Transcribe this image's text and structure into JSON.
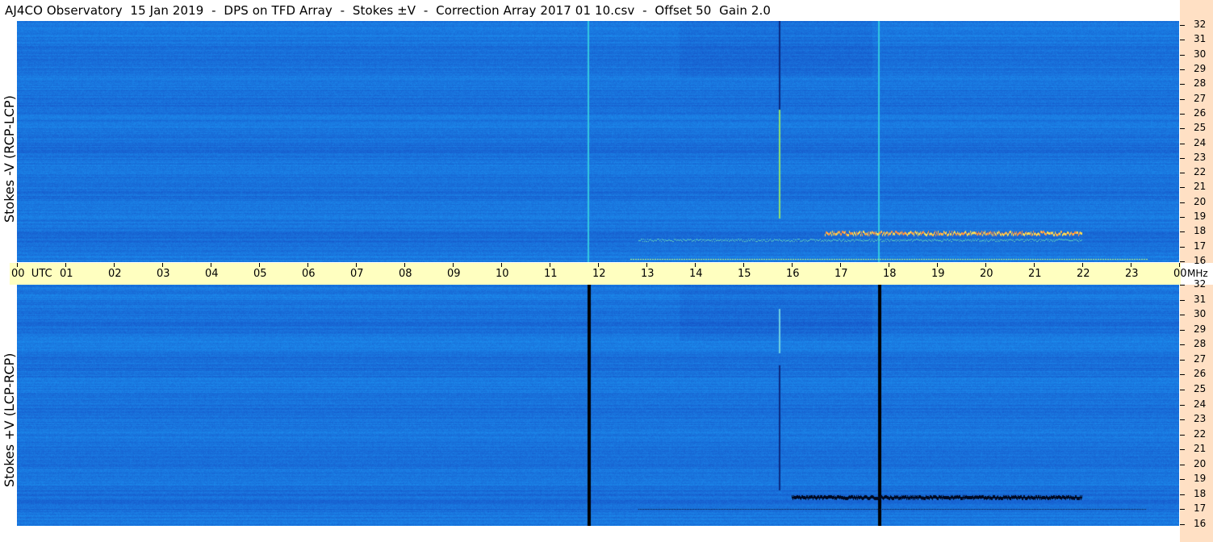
{
  "title": "AJ4CO Observatory  15 Jan 2019  -  DPS on TFD Array  -  Stokes ±V  -  Correction Array 2017 01 10.csv  -  Offset 50  Gain 2.0",
  "panels": {
    "top": {
      "label": "Stokes -V (RCP-LCP)"
    },
    "bottom": {
      "label": "Stokes +V (LCP-RCP)"
    }
  },
  "time_axis": {
    "labels": [
      "00  UTC",
      "01",
      "02",
      "03",
      "04",
      "05",
      "06",
      "07",
      "08",
      "09",
      "10",
      "11",
      "12",
      "13",
      "14",
      "15",
      "16",
      "17",
      "18",
      "19",
      "20",
      "21",
      "22",
      "23",
      "00"
    ]
  },
  "freq_axis": {
    "unit": "MHz",
    "labels": [
      "32",
      "31",
      "30",
      "29",
      "28",
      "27",
      "26",
      "25",
      "24",
      "23",
      "22",
      "21",
      "20",
      "19",
      "18",
      "17",
      "16"
    ]
  },
  "colors": {
    "background": "#1a6fe0",
    "time_bar": "#ffffc0",
    "freq_column": "#ffe0c4"
  }
}
